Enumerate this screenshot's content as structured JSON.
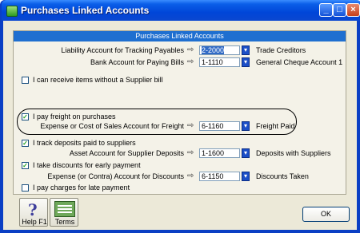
{
  "window": {
    "title": "Purchases Linked Accounts",
    "controls": [
      "minimize-icon",
      "maximize-icon",
      "close-icon"
    ]
  },
  "panel": {
    "header": "Purchases Linked Accounts"
  },
  "liability": {
    "label": "Liability Account for Tracking Payables",
    "value": "2-2000",
    "name": "Trade Creditors"
  },
  "bank": {
    "label": "Bank Account for Paying Bills",
    "value": "1-1110",
    "name": "General Cheque Account 1"
  },
  "receive_items": {
    "label": "I can receive items without a Supplier bill",
    "checked": false
  },
  "freight": {
    "label": "I pay freight on purchases",
    "checked": true,
    "account_label": "Expense or Cost of Sales Account for Freight",
    "value": "6-1160",
    "name": "Freight Paid"
  },
  "deposits": {
    "label": "I track deposits paid to suppliers",
    "checked": true,
    "account_label": "Asset Account for Supplier Deposits",
    "value": "1-1600",
    "name": "Deposits with Suppliers"
  },
  "discounts": {
    "label": "I take discounts for early payment",
    "checked": true,
    "account_label": "Expense (or Contra) Account for Discounts",
    "value": "6-1150",
    "name": "Discounts Taken"
  },
  "late_payment": {
    "label": "I pay charges for late payment",
    "checked": false
  },
  "buttons": {
    "help": "Help F1",
    "terms": "Terms",
    "ok": "OK"
  },
  "colors": {
    "titlebar": "#0a5ee8",
    "panel_header": "#1f6fd0",
    "window_bg": "#ece9d8",
    "selection": "#316ac5"
  }
}
